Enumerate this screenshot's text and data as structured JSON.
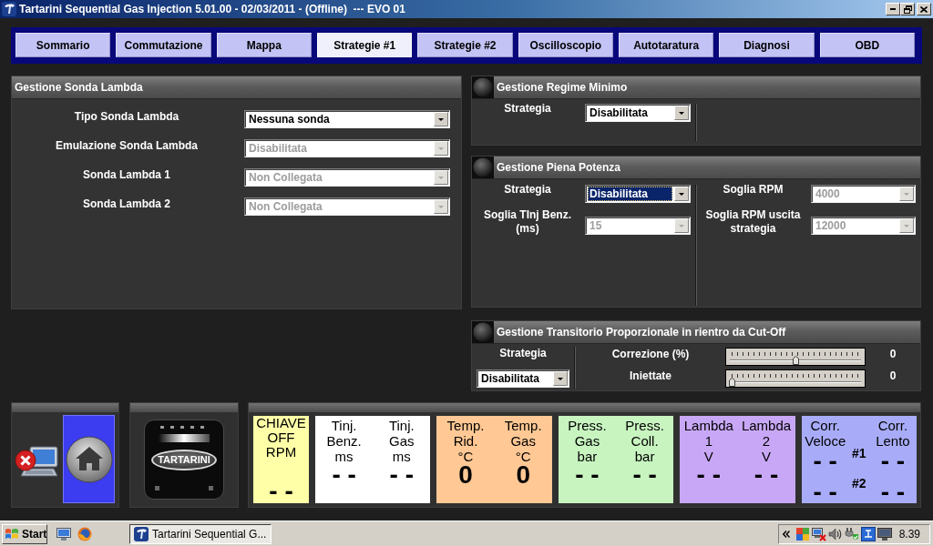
{
  "window": {
    "title": "Tartarini Sequential Gas Injection 5.01.00 - 02/03/2011 - (Offline)  --- EVO 01"
  },
  "tabs": [
    {
      "label": "Sommario",
      "selected": false
    },
    {
      "label": "Commutazione",
      "selected": false
    },
    {
      "label": "Mappa",
      "selected": false
    },
    {
      "label": "Strategie #1",
      "selected": true
    },
    {
      "label": "Strategie #2",
      "selected": false
    },
    {
      "label": "Oscilloscopio",
      "selected": false
    },
    {
      "label": "Autotaratura",
      "selected": false
    },
    {
      "label": "Diagnosi",
      "selected": false
    },
    {
      "label": "OBD",
      "selected": false
    }
  ],
  "lambda_panel": {
    "title": "Gestione Sonda Lambda",
    "fields": [
      {
        "label": "Tipo Sonda Lambda",
        "value": "Nessuna sonda",
        "disabled": false,
        "focused": false
      },
      {
        "label": "Emulazione Sonda Lambda",
        "value": "Disabilitata",
        "disabled": true,
        "focused": false
      },
      {
        "label": "Sonda Lambda 1",
        "value": "Non Collegata",
        "disabled": true,
        "focused": false
      },
      {
        "label": "Sonda Lambda 2",
        "value": "Non Collegata",
        "disabled": true,
        "focused": false
      }
    ]
  },
  "idle_panel": {
    "title": "Gestione Regime Minimo",
    "fields": [
      {
        "label": "Strategia",
        "value": "Disabilitata",
        "disabled": false,
        "focused": false
      }
    ]
  },
  "full_power_panel": {
    "title": "Gestione Piena Potenza",
    "left_fields": [
      {
        "label": "Strategia",
        "value": "Disabilitata",
        "disabled": false,
        "focused": true
      },
      {
        "label": "Soglia TInj Benz. (ms)",
        "value": "15",
        "disabled": true,
        "focused": false
      }
    ],
    "right_fields": [
      {
        "label": "Soglia RPM",
        "value": "4000",
        "disabled": true,
        "focused": false
      },
      {
        "label": "Soglia RPM uscita strategia",
        "value": "12000",
        "disabled": true,
        "focused": false
      }
    ]
  },
  "cutoff_panel": {
    "title": "Gestione Transitorio Proporzionale in rientro da Cut-Off",
    "strategy": {
      "label": "Strategia",
      "value": "Disabilitata",
      "disabled": false,
      "focused": false
    },
    "sliders": [
      {
        "label": "Correzione (%)",
        "level": 0.5,
        "reading": "0"
      },
      {
        "label": "Iniettate",
        "level": 0,
        "reading": "0"
      }
    ]
  },
  "logo": {
    "text": "TARTARINI"
  },
  "gauges": [
    {
      "kind": "single",
      "color": "#ffffa8",
      "columns": [
        {
          "label_lines": [
            "CHIAVE",
            "OFF",
            "RPM"
          ],
          "values": [
            "- -"
          ]
        }
      ]
    },
    {
      "kind": "pair",
      "color": "#ffffff",
      "columns": [
        {
          "label_lines": [
            "Tinj.",
            "Benz.",
            "ms"
          ],
          "values": [
            "- -"
          ]
        },
        {
          "label_lines": [
            "Tinj.",
            "Gas",
            "ms"
          ],
          "values": [
            "- -"
          ]
        }
      ]
    },
    {
      "kind": "pair",
      "color": "#ffc894",
      "columns": [
        {
          "label_lines": [
            "Temp.",
            "Rid.",
            "°C"
          ],
          "values": [
            "0"
          ]
        },
        {
          "label_lines": [
            "Temp.",
            "Gas",
            "°C"
          ],
          "values": [
            "0"
          ]
        }
      ]
    },
    {
      "kind": "pair",
      "color": "#c8f4c0",
      "columns": [
        {
          "label_lines": [
            "Press.",
            "Gas",
            "bar"
          ],
          "values": [
            "- -"
          ]
        },
        {
          "label_lines": [
            "Press.",
            "Coll.",
            "bar"
          ],
          "values": [
            "- -"
          ]
        }
      ]
    },
    {
      "kind": "pair",
      "color": "#c8a8f6",
      "columns": [
        {
          "label_lines": [
            "Lambda",
            "1",
            "V"
          ],
          "values": [
            "- -"
          ]
        },
        {
          "label_lines": [
            "Lambda",
            "2",
            "V"
          ],
          "values": [
            "- -"
          ]
        }
      ]
    },
    {
      "kind": "bank",
      "color": "#a8acf8",
      "banks": [
        "#1",
        "#2"
      ],
      "columns": [
        {
          "label_lines": [
            "Corr.",
            "Veloce"
          ],
          "values": [
            "- -",
            "- -"
          ]
        },
        {
          "label_lines": [
            "Corr.",
            "Lento"
          ],
          "values": [
            "- -",
            "- -"
          ]
        }
      ]
    }
  ],
  "taskbar": {
    "start": "Start",
    "task": "Tartarini Sequential G...",
    "clock": "8.39"
  }
}
